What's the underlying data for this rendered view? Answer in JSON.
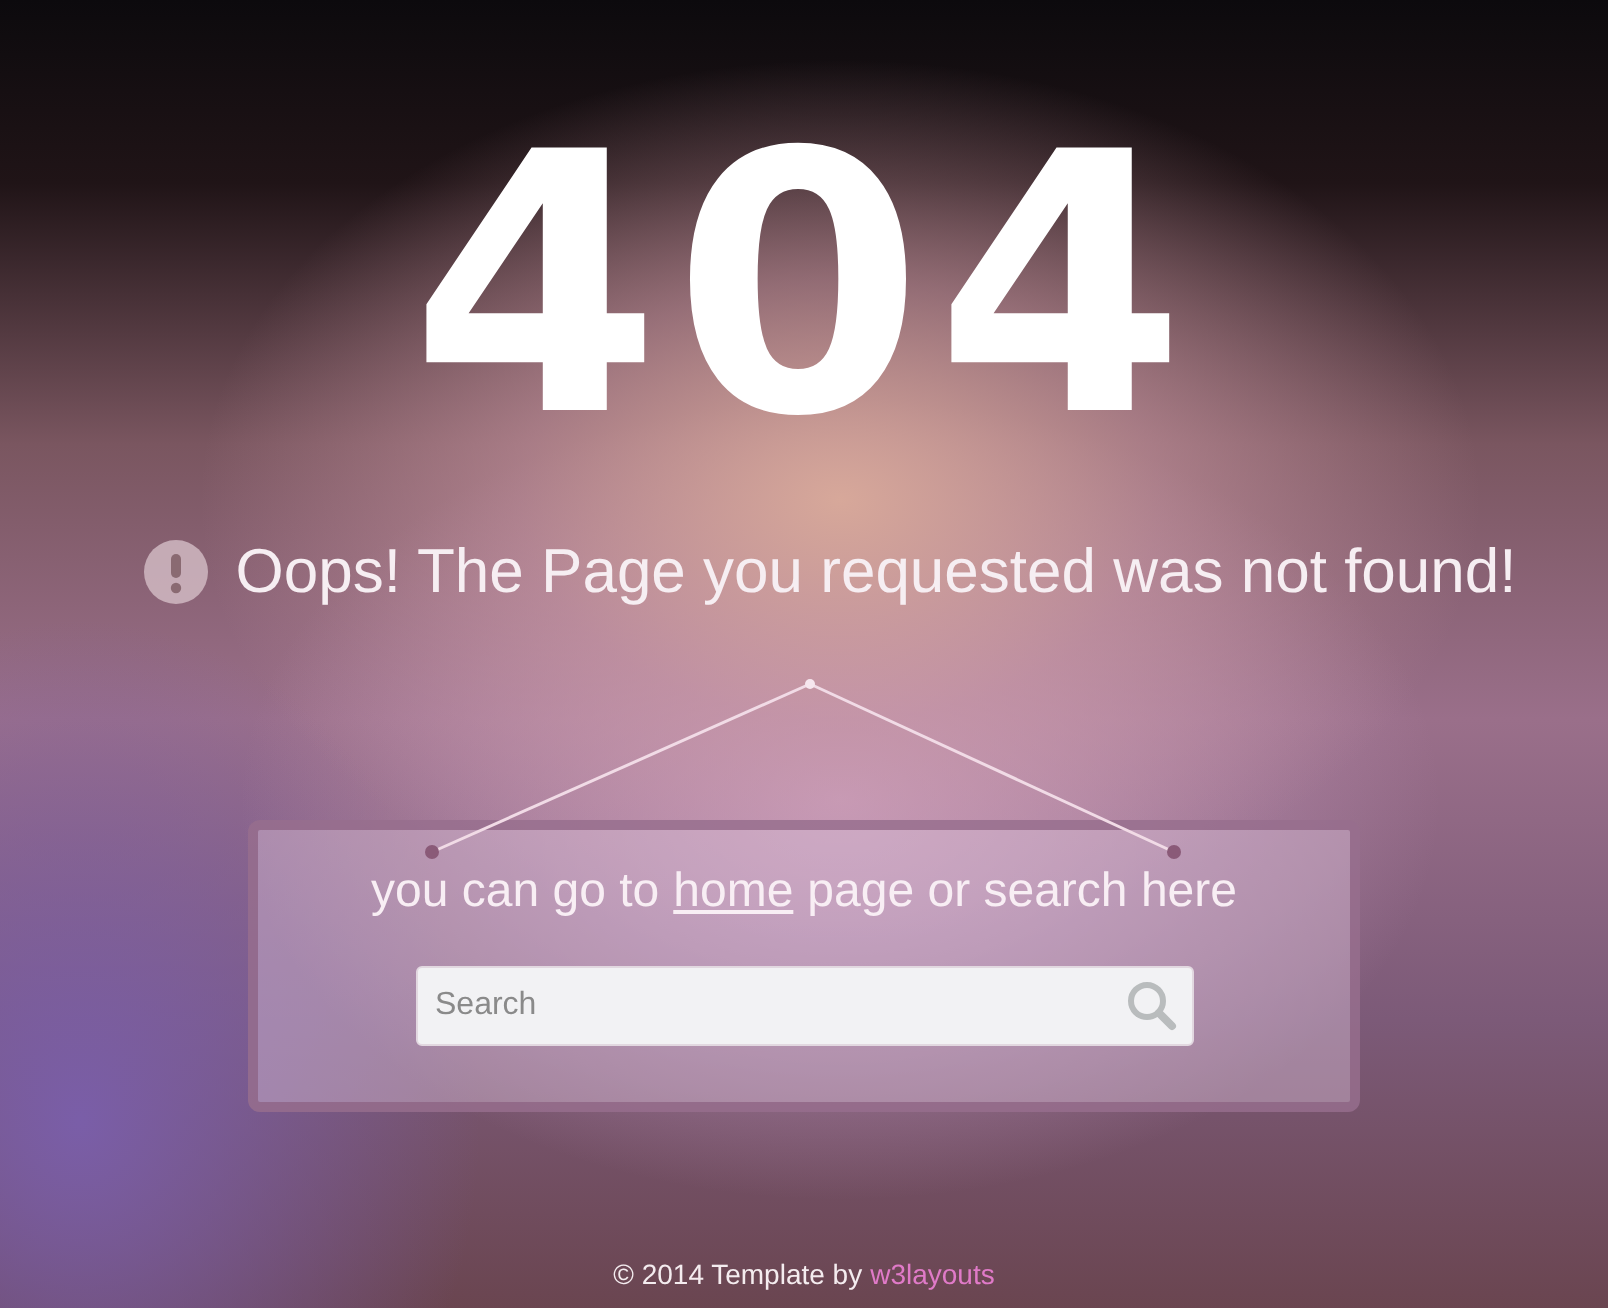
{
  "heading": "404",
  "message": "Oops! The Page you requested was not found!",
  "sign": {
    "before": "you can go to",
    "link": "home",
    "after": "page or search here"
  },
  "search": {
    "placeholder": "Search"
  },
  "footer": {
    "text": "© 2014 Template by",
    "link": "w3layouts"
  }
}
